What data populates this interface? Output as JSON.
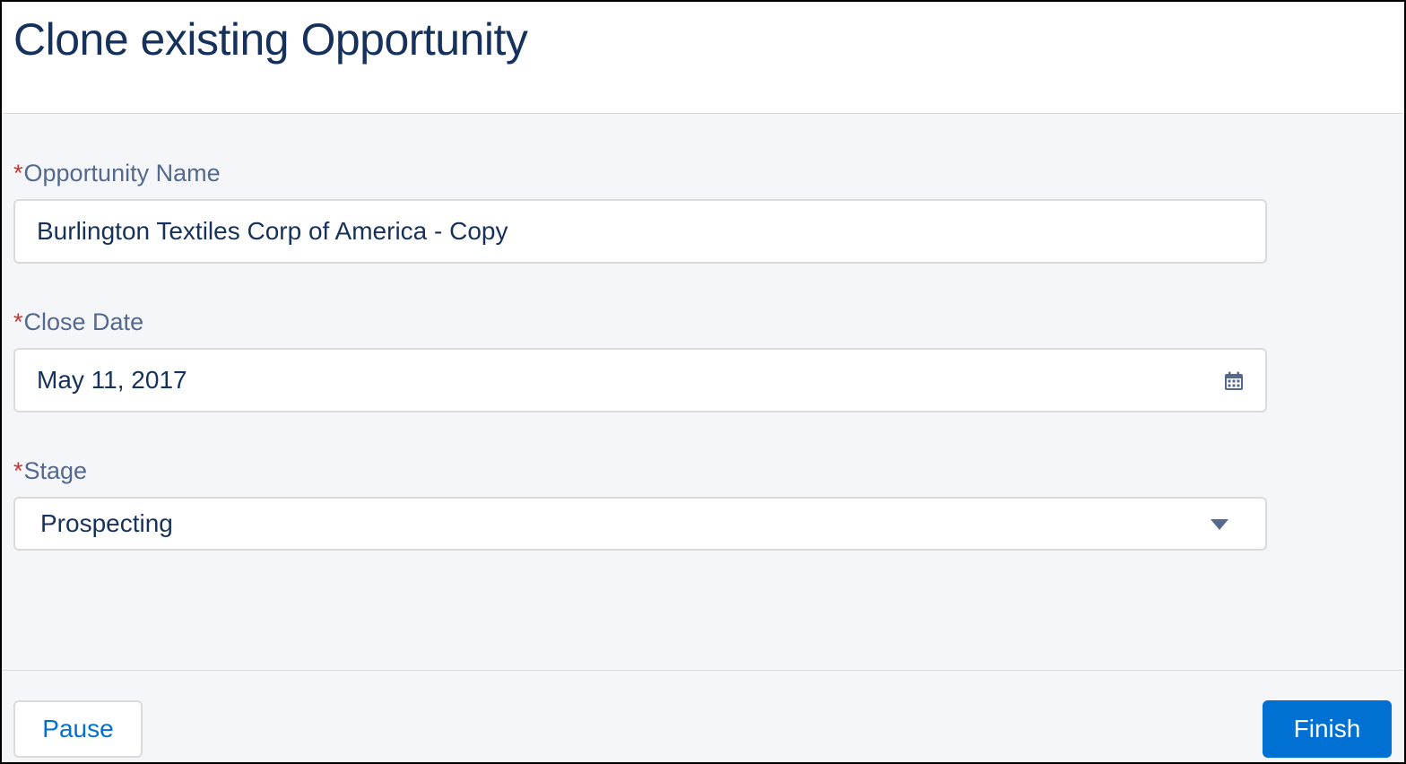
{
  "header": {
    "title": "Clone existing Opportunity"
  },
  "form": {
    "required_marker": "*",
    "opportunity_name": {
      "label": "Opportunity Name",
      "value": "Burlington Textiles Corp of America - Copy"
    },
    "close_date": {
      "label": "Close Date",
      "value": "May 11, 2017",
      "icon": "calendar-icon"
    },
    "stage": {
      "label": "Stage",
      "value": "Prospecting",
      "icon": "chevron-down-icon"
    }
  },
  "footer": {
    "pause_label": "Pause",
    "finish_label": "Finish"
  },
  "colors": {
    "title": "#16325c",
    "label": "#54698d",
    "required": "#c23934",
    "brand": "#0070d2",
    "background": "#f4f6f9",
    "border": "#dddbda"
  }
}
